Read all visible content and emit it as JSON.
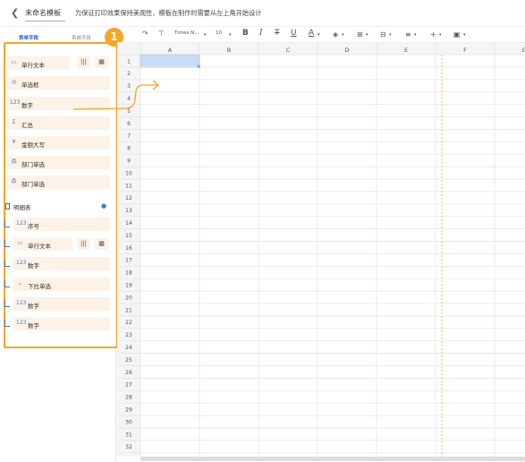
{
  "header": {
    "back_icon": "chevron-left-icon",
    "template_name": "未命名模板",
    "tip": "为保证打印效果保持美观性，模板在制作时需要从左上角开始设计"
  },
  "tabs": [
    {
      "label": "表单字段",
      "active": true
    },
    {
      "label": "系统字段",
      "active": false
    }
  ],
  "fields": [
    {
      "label": "单行文本",
      "icon": "text-input-icon"
    },
    {
      "label": "单选框",
      "icon": "radio-icon"
    },
    {
      "label": "数字",
      "icon": "number-icon"
    },
    {
      "label": "汇总",
      "icon": "sum-icon"
    },
    {
      "label": "金额大写",
      "icon": "currency-icon"
    },
    {
      "label": "部门单选",
      "icon": "org-icon"
    },
    {
      "label": "部门单选",
      "icon": "org-icon"
    }
  ],
  "detail_table": {
    "title": "明细表",
    "children": [
      {
        "label": "序号",
        "icon": "number-icon"
      },
      {
        "label": "单行文本",
        "icon": "text-input-icon"
      },
      {
        "label": "数字",
        "icon": "number-icon"
      },
      {
        "label": "下拉单选",
        "icon": "dropdown-icon"
      },
      {
        "label": "数字",
        "icon": "number-icon"
      },
      {
        "label": "数字",
        "icon": "number-icon"
      }
    ]
  },
  "callout_number": "1",
  "toolbar": {
    "font_name": "Times N...",
    "font_size": "10",
    "bold": "B",
    "italic": "I",
    "strike": "T",
    "underline": "U",
    "font_color": "A"
  },
  "columns": [
    "A",
    "B",
    "C",
    "D",
    "E",
    "F",
    "G"
  ],
  "rows": [
    "1",
    "2",
    "3",
    "4",
    "5",
    "6",
    "7",
    "8",
    "9",
    "10",
    "11",
    "12",
    "13",
    "14",
    "15",
    "16",
    "17",
    "18",
    "19",
    "20",
    "21",
    "22",
    "23",
    "24",
    "25",
    "26",
    "27",
    "28",
    "29",
    "30",
    "31",
    "32"
  ],
  "colors": {
    "accent": "#f5a623",
    "primary": "#2563c9",
    "selection": "#c9dcf5"
  }
}
